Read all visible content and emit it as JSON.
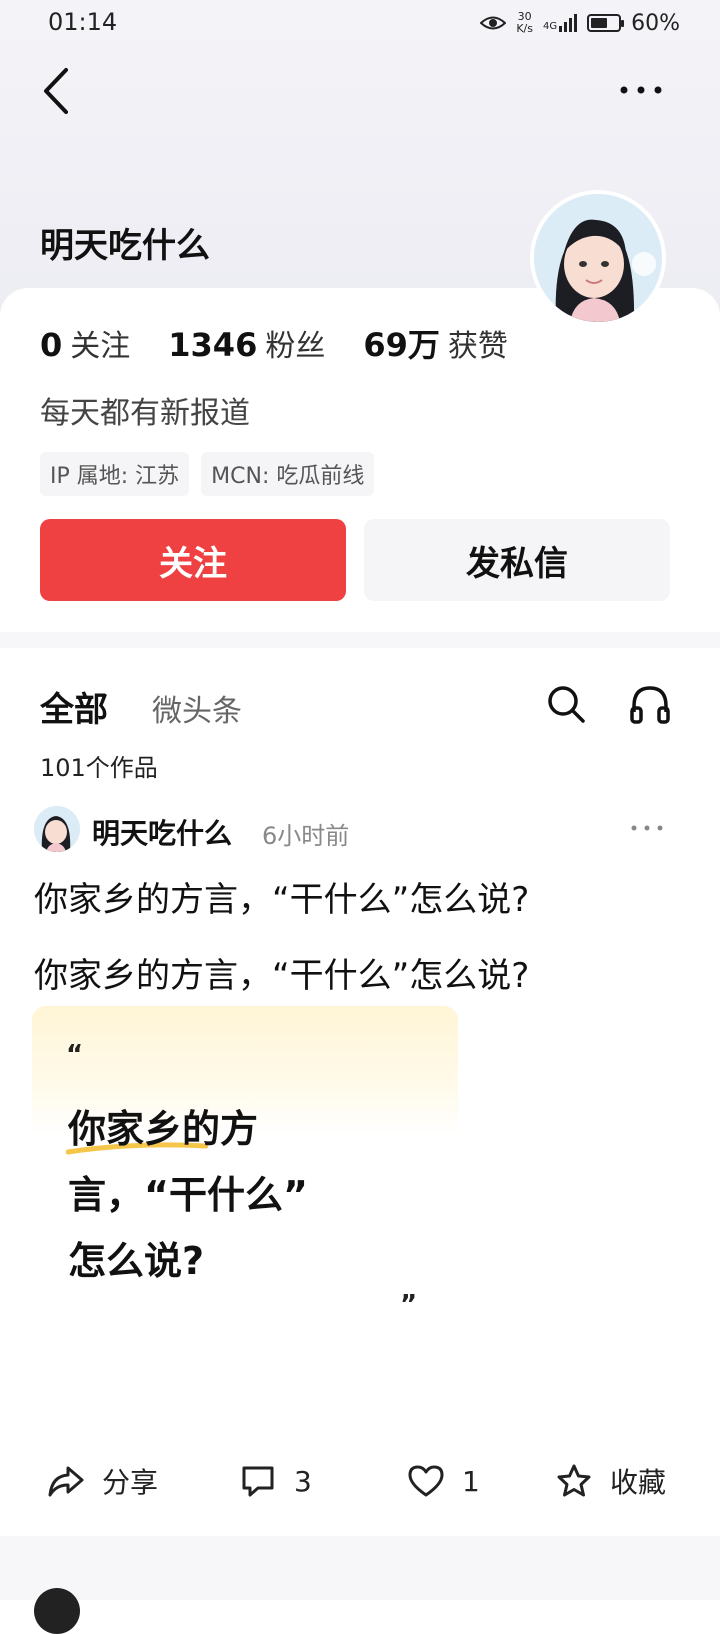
{
  "status_bar": {
    "time": "01:14",
    "net_speed_value": "30",
    "net_speed_unit": "K/s",
    "network": "4G",
    "battery_percent": "60%",
    "battery_level": 0.6
  },
  "icons": {
    "back": "back-chevron-icon",
    "more": "more-dots-icon",
    "search": "search-icon",
    "listen": "headphone-icon",
    "share": "share-icon",
    "comment": "comment-icon",
    "like": "heart-icon",
    "favorite": "star-icon"
  },
  "colors": {
    "follow_button": "#f04142",
    "header_bg": "#ececf3",
    "quote_highlight": "#f6c64a"
  },
  "profile": {
    "name": "明天吃什么",
    "stats": [
      {
        "num": "0",
        "label": "关注"
      },
      {
        "num": "1346",
        "label": "粉丝"
      },
      {
        "num": "69万",
        "label": "获赞"
      }
    ],
    "bio": "每天都有新报道",
    "tags": [
      "IP 属地: 江苏",
      "MCN: 吃瓜前线"
    ],
    "follow_label": "关注",
    "message_label": "发私信"
  },
  "tabs": {
    "all": "全部",
    "weitoutiao": "微头条"
  },
  "works_count": "101个作品",
  "post": {
    "author": "明天吃什么",
    "time": "6小时前",
    "text_lines": [
      "你家乡的方言，“干什么”怎么说?",
      "你家乡的方言，“干什么”怎么说?"
    ],
    "quote_open": "“",
    "quote_line1": "你家乡的方",
    "quote_line2": "言，“干什么”",
    "quote_line3": "怎么说?",
    "quote_close": "”",
    "actions": {
      "share": "分享",
      "comment_count": "3",
      "like_count": "1",
      "favorite": "收藏"
    }
  }
}
